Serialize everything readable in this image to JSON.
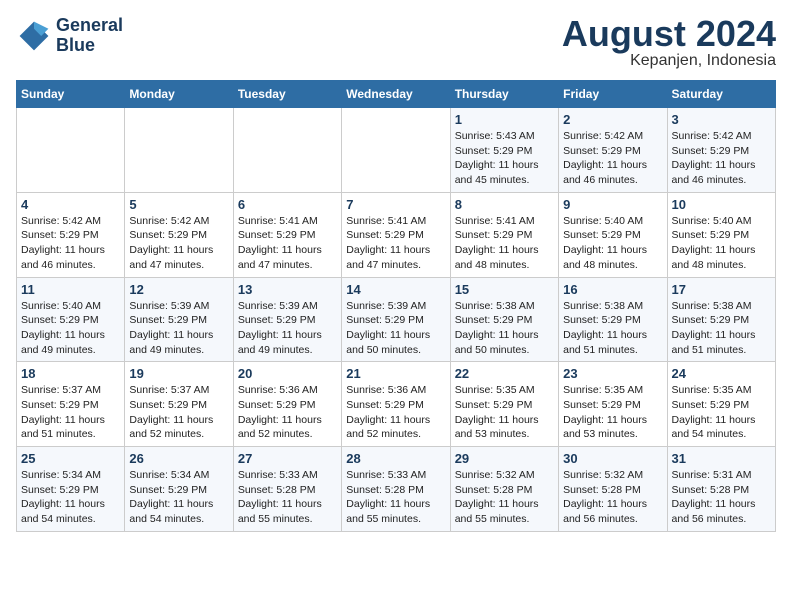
{
  "header": {
    "logo_line1": "General",
    "logo_line2": "Blue",
    "month_year": "August 2024",
    "location": "Kepanjen, Indonesia"
  },
  "days_of_week": [
    "Sunday",
    "Monday",
    "Tuesday",
    "Wednesday",
    "Thursday",
    "Friday",
    "Saturday"
  ],
  "weeks": [
    [
      {
        "day": "",
        "info": ""
      },
      {
        "day": "",
        "info": ""
      },
      {
        "day": "",
        "info": ""
      },
      {
        "day": "",
        "info": ""
      },
      {
        "day": "1",
        "info": "Sunrise: 5:43 AM\nSunset: 5:29 PM\nDaylight: 11 hours\nand 45 minutes."
      },
      {
        "day": "2",
        "info": "Sunrise: 5:42 AM\nSunset: 5:29 PM\nDaylight: 11 hours\nand 46 minutes."
      },
      {
        "day": "3",
        "info": "Sunrise: 5:42 AM\nSunset: 5:29 PM\nDaylight: 11 hours\nand 46 minutes."
      }
    ],
    [
      {
        "day": "4",
        "info": "Sunrise: 5:42 AM\nSunset: 5:29 PM\nDaylight: 11 hours\nand 46 minutes."
      },
      {
        "day": "5",
        "info": "Sunrise: 5:42 AM\nSunset: 5:29 PM\nDaylight: 11 hours\nand 47 minutes."
      },
      {
        "day": "6",
        "info": "Sunrise: 5:41 AM\nSunset: 5:29 PM\nDaylight: 11 hours\nand 47 minutes."
      },
      {
        "day": "7",
        "info": "Sunrise: 5:41 AM\nSunset: 5:29 PM\nDaylight: 11 hours\nand 47 minutes."
      },
      {
        "day": "8",
        "info": "Sunrise: 5:41 AM\nSunset: 5:29 PM\nDaylight: 11 hours\nand 48 minutes."
      },
      {
        "day": "9",
        "info": "Sunrise: 5:40 AM\nSunset: 5:29 PM\nDaylight: 11 hours\nand 48 minutes."
      },
      {
        "day": "10",
        "info": "Sunrise: 5:40 AM\nSunset: 5:29 PM\nDaylight: 11 hours\nand 48 minutes."
      }
    ],
    [
      {
        "day": "11",
        "info": "Sunrise: 5:40 AM\nSunset: 5:29 PM\nDaylight: 11 hours\nand 49 minutes."
      },
      {
        "day": "12",
        "info": "Sunrise: 5:39 AM\nSunset: 5:29 PM\nDaylight: 11 hours\nand 49 minutes."
      },
      {
        "day": "13",
        "info": "Sunrise: 5:39 AM\nSunset: 5:29 PM\nDaylight: 11 hours\nand 49 minutes."
      },
      {
        "day": "14",
        "info": "Sunrise: 5:39 AM\nSunset: 5:29 PM\nDaylight: 11 hours\nand 50 minutes."
      },
      {
        "day": "15",
        "info": "Sunrise: 5:38 AM\nSunset: 5:29 PM\nDaylight: 11 hours\nand 50 minutes."
      },
      {
        "day": "16",
        "info": "Sunrise: 5:38 AM\nSunset: 5:29 PM\nDaylight: 11 hours\nand 51 minutes."
      },
      {
        "day": "17",
        "info": "Sunrise: 5:38 AM\nSunset: 5:29 PM\nDaylight: 11 hours\nand 51 minutes."
      }
    ],
    [
      {
        "day": "18",
        "info": "Sunrise: 5:37 AM\nSunset: 5:29 PM\nDaylight: 11 hours\nand 51 minutes."
      },
      {
        "day": "19",
        "info": "Sunrise: 5:37 AM\nSunset: 5:29 PM\nDaylight: 11 hours\nand 52 minutes."
      },
      {
        "day": "20",
        "info": "Sunrise: 5:36 AM\nSunset: 5:29 PM\nDaylight: 11 hours\nand 52 minutes."
      },
      {
        "day": "21",
        "info": "Sunrise: 5:36 AM\nSunset: 5:29 PM\nDaylight: 11 hours\nand 52 minutes."
      },
      {
        "day": "22",
        "info": "Sunrise: 5:35 AM\nSunset: 5:29 PM\nDaylight: 11 hours\nand 53 minutes."
      },
      {
        "day": "23",
        "info": "Sunrise: 5:35 AM\nSunset: 5:29 PM\nDaylight: 11 hours\nand 53 minutes."
      },
      {
        "day": "24",
        "info": "Sunrise: 5:35 AM\nSunset: 5:29 PM\nDaylight: 11 hours\nand 54 minutes."
      }
    ],
    [
      {
        "day": "25",
        "info": "Sunrise: 5:34 AM\nSunset: 5:29 PM\nDaylight: 11 hours\nand 54 minutes."
      },
      {
        "day": "26",
        "info": "Sunrise: 5:34 AM\nSunset: 5:29 PM\nDaylight: 11 hours\nand 54 minutes."
      },
      {
        "day": "27",
        "info": "Sunrise: 5:33 AM\nSunset: 5:28 PM\nDaylight: 11 hours\nand 55 minutes."
      },
      {
        "day": "28",
        "info": "Sunrise: 5:33 AM\nSunset: 5:28 PM\nDaylight: 11 hours\nand 55 minutes."
      },
      {
        "day": "29",
        "info": "Sunrise: 5:32 AM\nSunset: 5:28 PM\nDaylight: 11 hours\nand 55 minutes."
      },
      {
        "day": "30",
        "info": "Sunrise: 5:32 AM\nSunset: 5:28 PM\nDaylight: 11 hours\nand 56 minutes."
      },
      {
        "day": "31",
        "info": "Sunrise: 5:31 AM\nSunset: 5:28 PM\nDaylight: 11 hours\nand 56 minutes."
      }
    ]
  ]
}
